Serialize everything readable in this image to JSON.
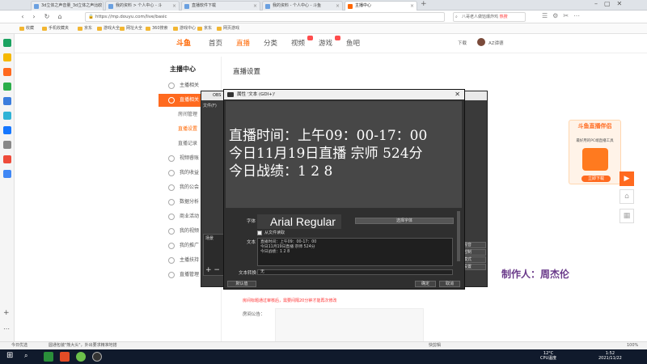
{
  "browser": {
    "tabs": [
      {
        "label": "3d立体之声音量_3d立体之声比较"
      },
      {
        "label": "我的资料 > 个人中心 - 斗"
      },
      {
        "label": "直播软件下载"
      },
      {
        "label": "我的资料 - 个人中心 - 斗鱼"
      },
      {
        "label": "主播中心",
        "active": true
      }
    ],
    "url": "https://mp.douyu.com/live/basic",
    "search_text": "八哥老人做馅爆炸鸡",
    "search_badge": "热搜",
    "bookmarks": [
      "收藏",
      "手机收藏夹",
      "京东",
      "游戏大全",
      "网址大全",
      "360搜索",
      "游戏中心",
      "京东",
      "网页游戏"
    ]
  },
  "site": {
    "logo": "斗鱼",
    "nav": [
      "首页",
      "直播",
      "分类",
      "视频",
      "游戏",
      "鱼吧"
    ],
    "active_nav": "直播",
    "download": "下载",
    "username": "AZ谭德"
  },
  "sidebar": {
    "title": "主播中心",
    "items": [
      {
        "label": "主播相关",
        "icon": "mic-icon"
      },
      {
        "label": "直播相关",
        "icon": "live-icon",
        "active": true
      },
      {
        "label": "房间管理",
        "sub": true
      },
      {
        "label": "直播设置",
        "sub": true,
        "on": true
      },
      {
        "label": "直播记录",
        "sub": true
      },
      {
        "label": "视频睿账",
        "icon": "video-icon"
      },
      {
        "label": "我的收益",
        "icon": "coin-icon"
      },
      {
        "label": "我的公会",
        "icon": "guild-icon"
      },
      {
        "label": "数据分析",
        "icon": "chart-icon"
      },
      {
        "label": "商业活动",
        "icon": "shop-icon"
      },
      {
        "label": "我的视频",
        "icon": "film-icon"
      },
      {
        "label": "我的推广",
        "icon": "promo-icon"
      },
      {
        "label": "主播扶持",
        "icon": "support-icon"
      },
      {
        "label": "直播管理",
        "icon": "manage-icon"
      }
    ]
  },
  "content": {
    "title": "直播设置",
    "tip": "房间标题通过审核后，需要间隔20分钟才能再次修改",
    "announce_label": "房间公告："
  },
  "obs": {
    "title": "OBS",
    "menu": "文件(F)",
    "scene_label": "场景",
    "controls": [
      "混音",
      "控制",
      "模式",
      "设置"
    ]
  },
  "dialog": {
    "title": "属性 '文本 (GDI+)'",
    "preview_lines": [
      "直播时间：上午09：00-17：00",
      "今日11月19日直播 宗师 524分",
      "今日战绩：1 2 8"
    ],
    "font_label": "字体",
    "font_value": "Arial Regular",
    "select_font": "选择字体",
    "from_file": "从文件读取",
    "text_label": "文本",
    "text_lines": [
      "直播时间：上午09：00-17：00",
      "今日11月19日直播 宗师 524分",
      "今日战绩：1 2 8"
    ],
    "transform_label": "文本转换",
    "transform_value": "无",
    "defaults": "默认值",
    "ok": "确定",
    "cancel": "取消"
  },
  "ad": {
    "title": "斗鱼直播伴侣",
    "subtitle": "最好用的PC端直播工具",
    "button": "立即下载"
  },
  "maker": "制作人：周杰伦",
  "statusbar": {
    "left": "今日优选",
    "news": "圆通包装\"熊大头\"，外出要求精准地搭",
    "right": "快剪辑",
    "zoom": "100%"
  },
  "taskbar": {
    "temp": "12°C",
    "cpu": "CPU温度",
    "time": "1:52",
    "date": "2021/11/22"
  }
}
